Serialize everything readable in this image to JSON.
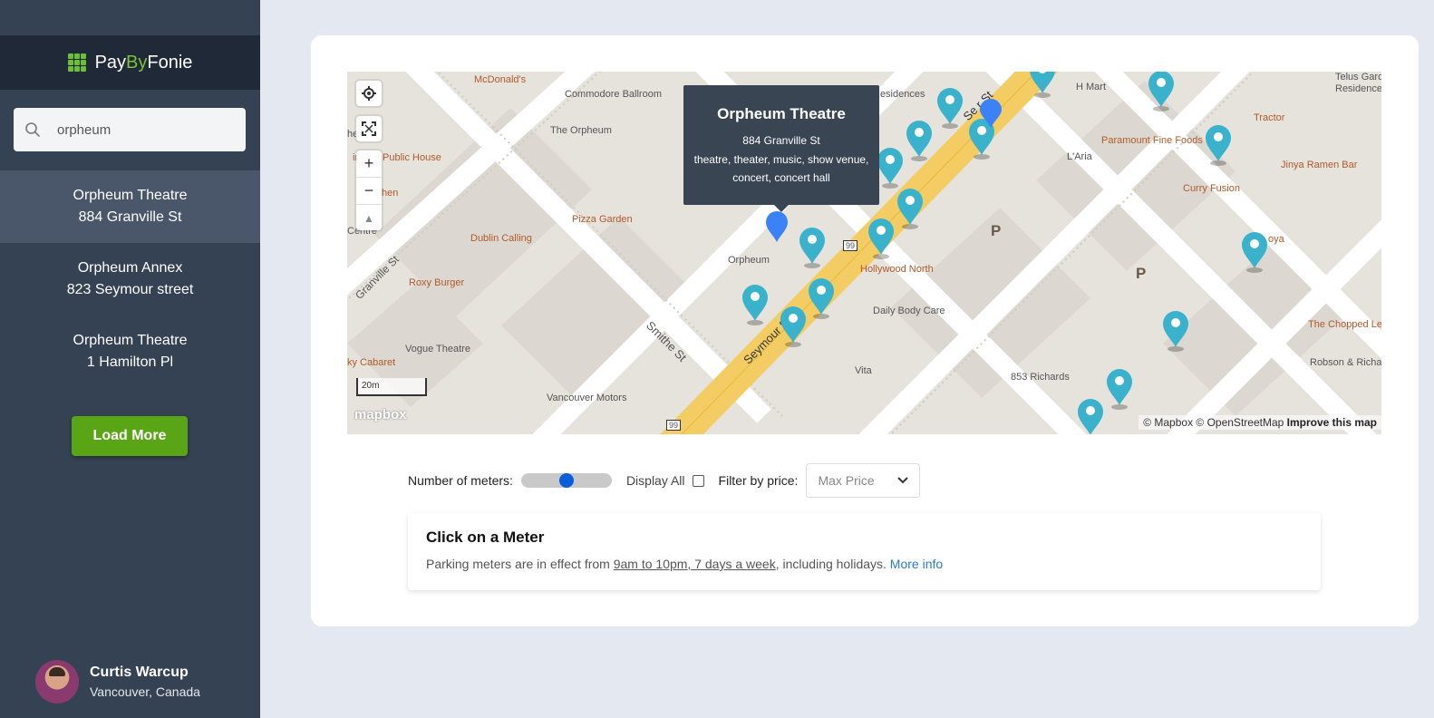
{
  "brand": {
    "pre": "Pay",
    "mid": "By",
    "post": "Fonie",
    "accent_color": "#7cc13a"
  },
  "search": {
    "value": "orpheum",
    "placeholder": ""
  },
  "results": [
    {
      "name": "Orpheum Theatre",
      "address": "884 Granville St",
      "active": true
    },
    {
      "name": "Orpheum Annex",
      "address": "823 Seymour street",
      "active": false
    },
    {
      "name": "Orpheum Theatre",
      "address": "1 Hamilton Pl",
      "active": false
    }
  ],
  "load_more_label": "Load More",
  "user": {
    "name": "Curtis Warcup",
    "location": "Vancouver, Canada"
  },
  "map": {
    "popup": {
      "title": "Orpheum Theatre",
      "address": "884 Granville St",
      "tags": "theatre, theater, music, show venue, concert, concert hall"
    },
    "scale_label": "20m",
    "logo": "mapbox",
    "attribution": "© Mapbox © OpenStreetMap",
    "attribution_link": "Improve this map",
    "labels": {
      "mcdonalds": "McDonald's",
      "commodore": "Commodore Ballroom",
      "the_orpheum": "The Orpheum",
      "cinema": "inema Public House",
      "kitchen": "-Kitchen",
      "ham": "he ham",
      "pizza": "Pizza Garden",
      "dublin": "Dublin Calling",
      "centre": "Centre",
      "orpheum": "Orpheum",
      "roxy": "Roxy Burger",
      "hollywood": "Hollywood North",
      "daily": "Daily Body Care",
      "vogue": "Vogue Theatre",
      "cabaret": "ky Cabaret",
      "vancouver_motors": "Vancouver Motors",
      "vita": "Vita",
      "richards853": "853 Richards",
      "residences": "Residences",
      "hmart": "H Mart",
      "laria": "L'Aria",
      "paramount": "Paramount Fine Foods",
      "tractor": "Tractor",
      "curry": "Curry Fusion",
      "jinya": "Jinya Ramen Bar",
      "telus": "Telus Garde",
      "telus2": "Residences",
      "oya": "oya",
      "chopped": "The Chopped Le",
      "robson": "Robson & Richards",
      "granville_st": "Granville St",
      "smithe_st": "Smithe St",
      "seymour": "Seymour S",
      "seymour_st_top": "Se   r St",
      "hwy": "99",
      "parking": "P"
    }
  },
  "controls": {
    "meters_label": "Number of meters:",
    "meters_value": 0.5,
    "display_all_label": "Display All",
    "display_all_checked": false,
    "filter_label": "Filter by price:",
    "max_price_placeholder": "Max Price"
  },
  "info": {
    "title": "Click on a Meter",
    "text_before": "Parking meters are in effect from ",
    "hours": "9am to 10pm, 7 days a week",
    "text_after": ", including holidays. ",
    "more_link": "More info"
  }
}
